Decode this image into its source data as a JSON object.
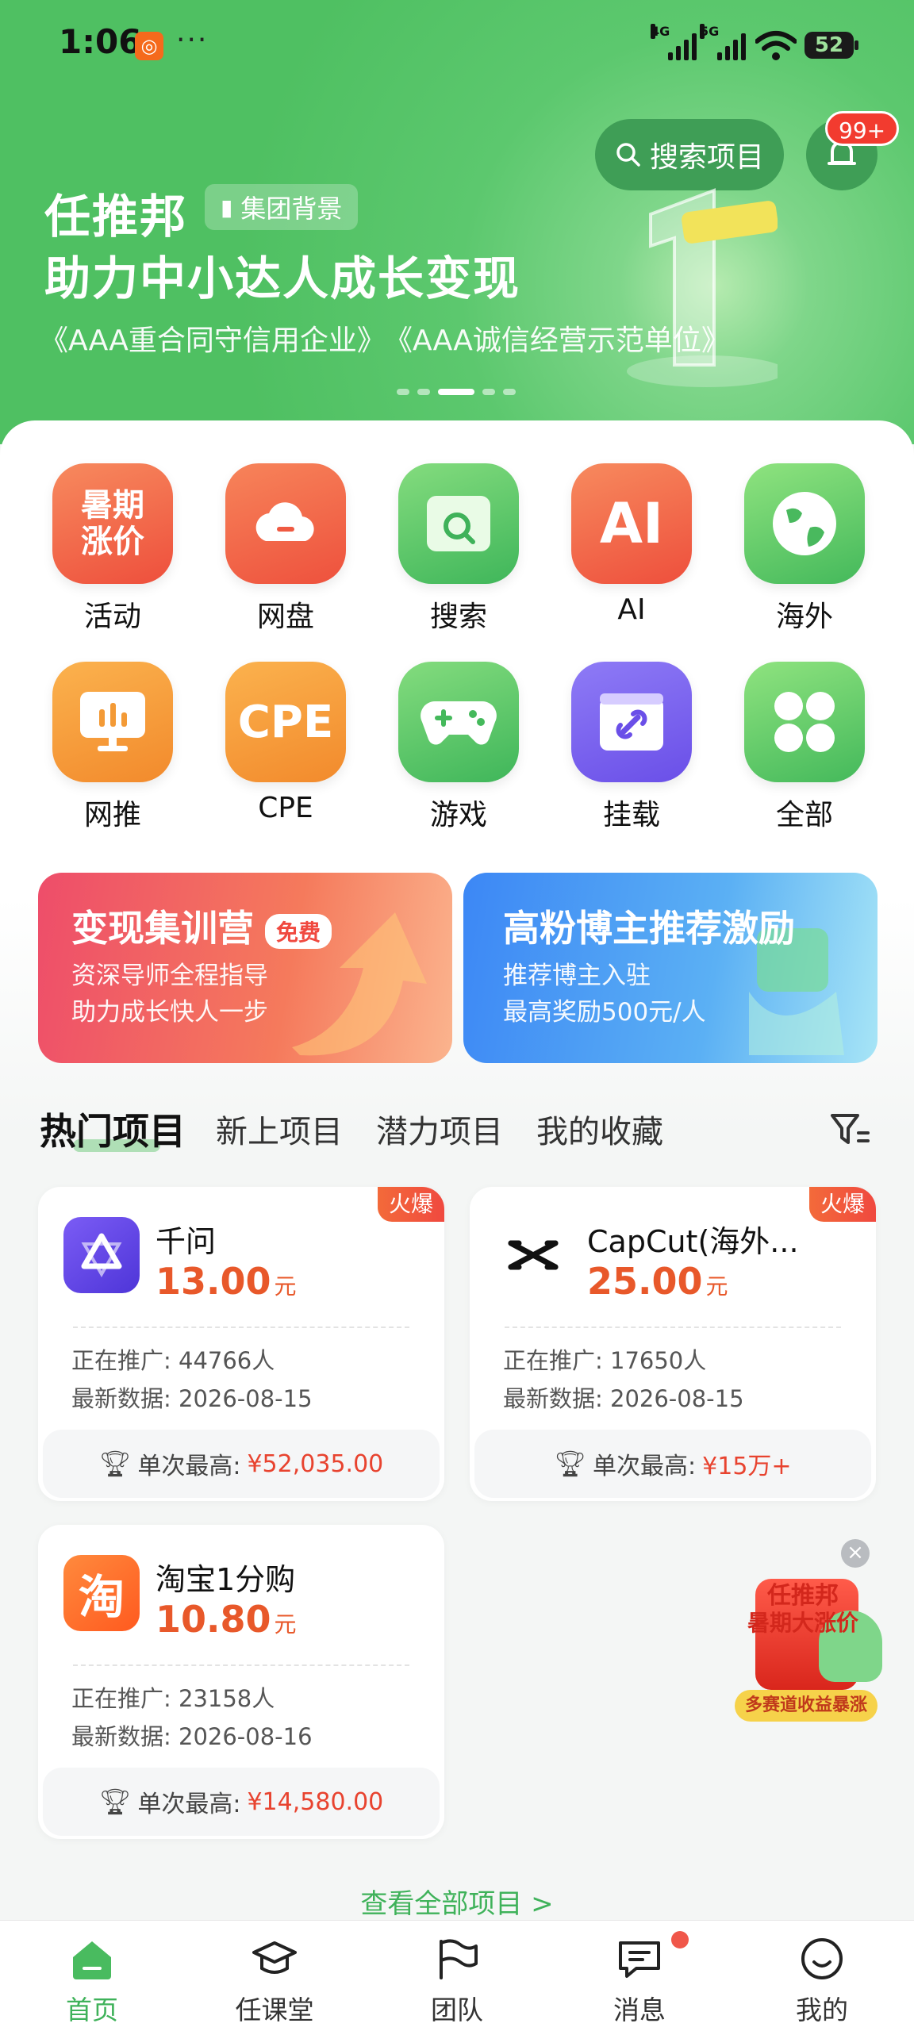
{
  "status_bar": {
    "time": "1:06",
    "more": "···",
    "net1": "4G",
    "net2": "5G",
    "battery": "52"
  },
  "header": {
    "search_label": "搜索项目",
    "notify_badge": "99+",
    "brand": "任推邦",
    "group_tag": "集团背景",
    "slogan": "助力中小达人成长变现",
    "honors": [
      "AAA重合同守信用企业",
      "AAA诚信经营示范单位"
    ],
    "carousel": {
      "count": 5,
      "active": 2
    }
  },
  "quick_grid": [
    {
      "label": "活动",
      "icon_text": "暑期涨价",
      "icon": "summer-price-icon"
    },
    {
      "label": "网盘",
      "icon": "cloud-disk-icon"
    },
    {
      "label": "搜索",
      "icon": "search-app-icon"
    },
    {
      "label": "AI",
      "icon_text": "AI",
      "icon": "ai-icon"
    },
    {
      "label": "海外",
      "icon": "globe-icon"
    },
    {
      "label": "网推",
      "icon": "monitor-chart-icon"
    },
    {
      "label": "CPE",
      "icon_text": "CPE",
      "icon": "cpe-icon"
    },
    {
      "label": "游戏",
      "icon": "gamepad-icon"
    },
    {
      "label": "挂载",
      "icon": "link-clip-icon"
    },
    {
      "label": "全部",
      "icon": "all-apps-icon"
    }
  ],
  "promos": [
    {
      "title": "变现集训营",
      "tag": "免费",
      "line1": "资深导师全程指导",
      "line2": "助力成长快人一步"
    },
    {
      "title": "高粉博主推荐激励",
      "line1": "推荐博主入驻",
      "line2": "最高奖励500元/人"
    }
  ],
  "tabs": [
    "热门项目",
    "新上项目",
    "潜力项目",
    "我的收藏"
  ],
  "projects": [
    {
      "name": "千问",
      "price": "13.00",
      "unit": "元",
      "hot": "火爆",
      "promoting": "正在推广: 44766人",
      "latest": "最新数据: 2026-08-15",
      "best_label": "单次最高:",
      "best_value": "¥52,035.00"
    },
    {
      "name": "CapCut(海外...",
      "price": "25.00",
      "unit": "元",
      "hot": "火爆",
      "promoting": "正在推广: 17650人",
      "latest": "最新数据: 2026-08-15",
      "best_label": "单次最高:",
      "best_value": "¥15万+"
    },
    {
      "name": "淘宝1分购",
      "price": "10.80",
      "unit": "元",
      "promoting": "正在推广: 23158人",
      "latest": "最新数据: 2026-08-16",
      "best_label": "单次最高:",
      "best_value": "¥14,580.00"
    }
  ],
  "floater": {
    "line1": "任推邦",
    "line2": "暑期大涨价",
    "line3": "多赛道收益暴涨",
    "close": "×"
  },
  "view_all": "查看全部项目 >",
  "bottom_nav": [
    {
      "label": "首页",
      "active": true
    },
    {
      "label": "任课堂"
    },
    {
      "label": "团队"
    },
    {
      "label": "消息",
      "dot": true
    },
    {
      "label": "我的"
    }
  ],
  "colors": {
    "accent": "#3fb25a",
    "price": "#e8582a",
    "hot": "#f0493f"
  }
}
